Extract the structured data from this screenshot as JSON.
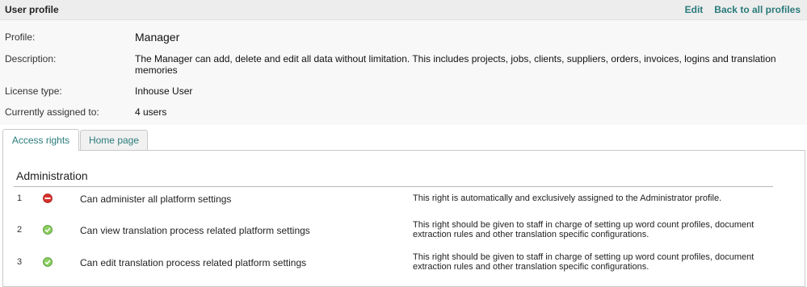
{
  "header": {
    "title": "User profile",
    "edit_label": "Edit",
    "back_label": "Back to all profiles"
  },
  "details": {
    "profile_label": "Profile:",
    "profile_value": "Manager",
    "description_label": "Description:",
    "description_value": "The Manager can add, delete and edit all data without limitation. This includes projects, jobs, clients, suppliers, orders, invoices, logins and translation memories",
    "license_label": "License type:",
    "license_value": "Inhouse User",
    "assigned_label": "Currently assigned to:",
    "assigned_value": "4 users"
  },
  "tabs": [
    {
      "label": "Access rights",
      "active": true
    },
    {
      "label": "Home page",
      "active": false
    }
  ],
  "section": {
    "title": "Administration"
  },
  "rights": [
    {
      "num": "1",
      "status": "denied",
      "icon": "no-entry-icon",
      "color": "#d9302b",
      "name": "Can administer all platform settings",
      "desc": "This right is automatically and exclusively assigned to the Administrator profile."
    },
    {
      "num": "2",
      "status": "granted",
      "icon": "check-icon",
      "color": "#69b445",
      "name": "Can view translation process related platform settings",
      "desc": "This right should be given to staff in charge of setting up word count profiles, document extraction rules and other translation specific configurations."
    },
    {
      "num": "3",
      "status": "granted",
      "icon": "check-icon",
      "color": "#69b445",
      "name": "Can edit translation process related platform settings",
      "desc": "This right should be given to staff in charge of setting up word count profiles, document extraction rules and other translation specific configurations."
    }
  ]
}
